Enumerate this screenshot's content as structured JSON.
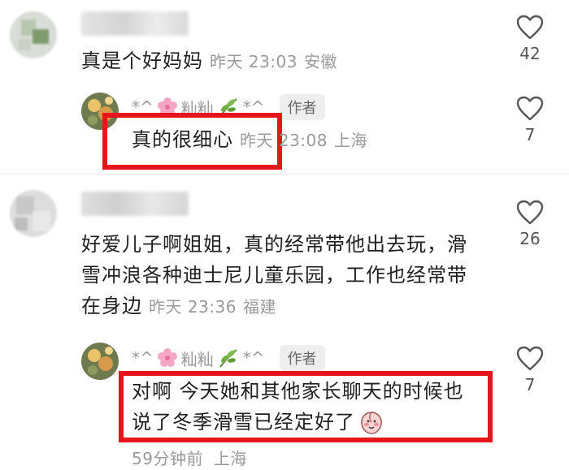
{
  "comments": [
    {
      "text": "真是个好妈妈",
      "time": "昨天 23:03",
      "location": "安徽",
      "likes": "42",
      "reply": {
        "name_left": "*^",
        "name_mid": "籼籼",
        "name_right": "*^",
        "badge": "作者",
        "text": "真的很细心",
        "time": "昨天 23:08",
        "location": "上海",
        "likes": "7"
      }
    },
    {
      "text_lines": [
        "好爱儿子啊姐姐，真的经常带他出去玩，滑",
        "雪冲浪各种迪士尼儿童乐园，工作也经常带",
        "在身边"
      ],
      "time": "昨天 23:36",
      "location": "福建",
      "likes": "26",
      "reply": {
        "name_left": "*^",
        "name_mid": "籼籼",
        "name_right": "*^",
        "badge": "作者",
        "text_lines": [
          "对啊 今天她和其他家长聊天的时候也",
          "说了冬季滑雪已经定好了"
        ],
        "time": "59分钟前",
        "location": "上海",
        "likes": "7"
      }
    }
  ],
  "icons": {
    "like": "heart-outline-icon",
    "flower": "cherry-blossom-icon",
    "herb": "herb-leaf-icon",
    "emoji": "peach-face-emoji-icon"
  },
  "colors": {
    "highlight_box": "#e8141c",
    "meta_text": "#9a9a9a",
    "badge_bg": "#eeeeee"
  }
}
